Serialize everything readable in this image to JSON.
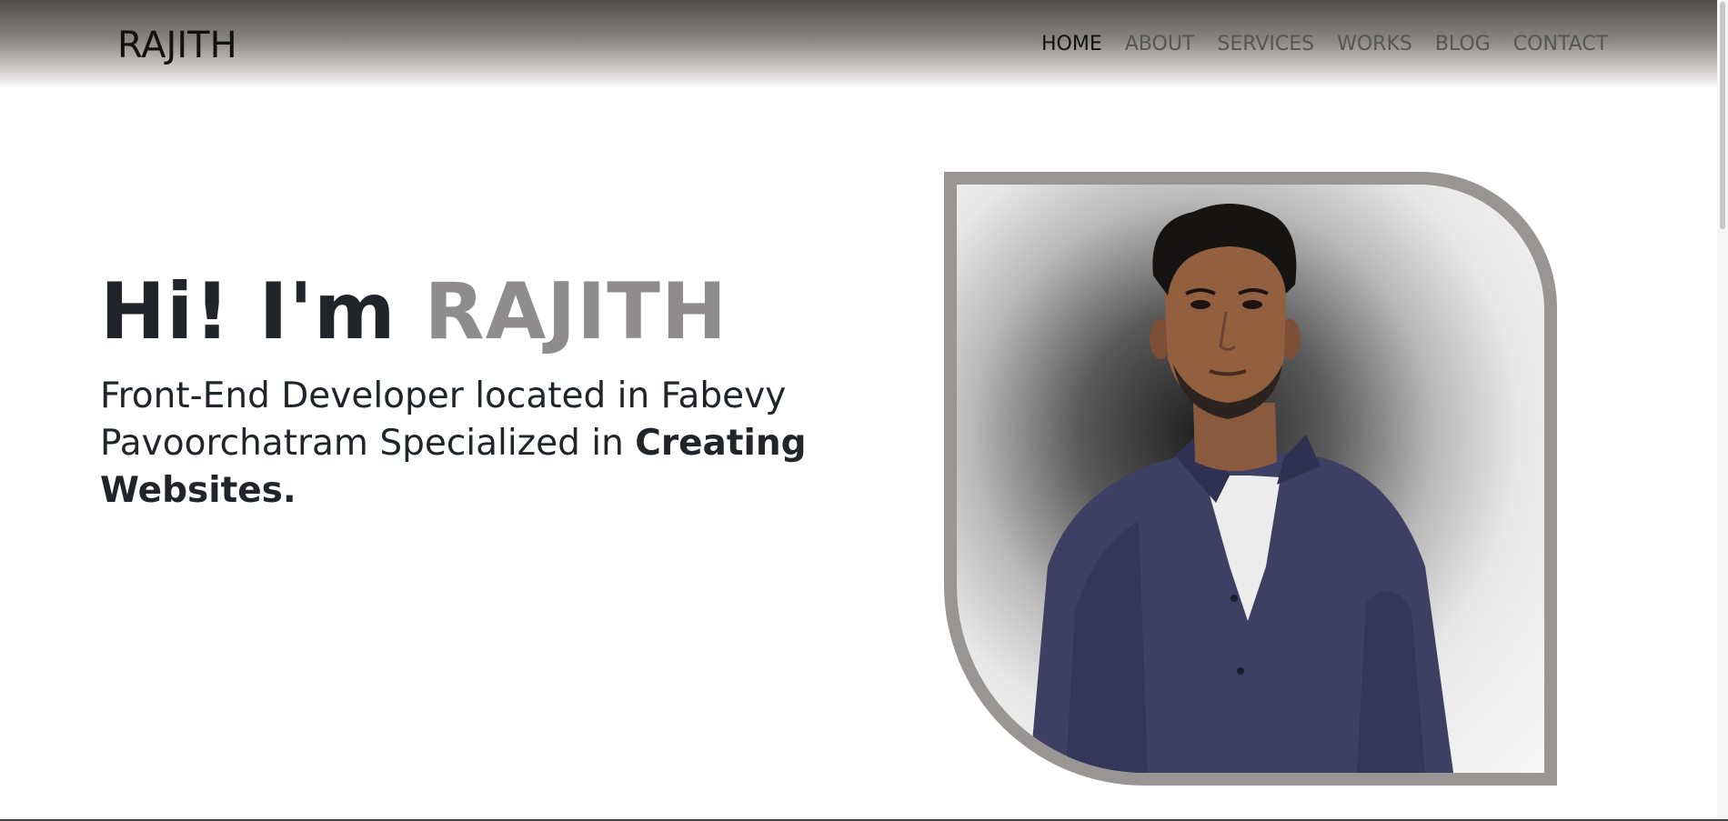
{
  "header": {
    "logo": "RAJITH",
    "nav": [
      {
        "label": "HOME",
        "active": true
      },
      {
        "label": "ABOUT",
        "active": false
      },
      {
        "label": "SERVICES",
        "active": false
      },
      {
        "label": "WORKS",
        "active": false
      },
      {
        "label": "BLOG",
        "active": false
      },
      {
        "label": "CONTACT",
        "active": false
      }
    ]
  },
  "hero": {
    "greeting": "Hi! I'm",
    "name": "RAJITH",
    "subtitle_plain": "Front-End Developer located in Fabevy Pavoorchatram Specialized in",
    "subtitle_bold": "Creating Websites.",
    "portrait_icon": "profile-photo"
  },
  "colors": {
    "name_accent": "#8e8c8c",
    "frame": "#999595",
    "header_top": "#504c4c"
  }
}
